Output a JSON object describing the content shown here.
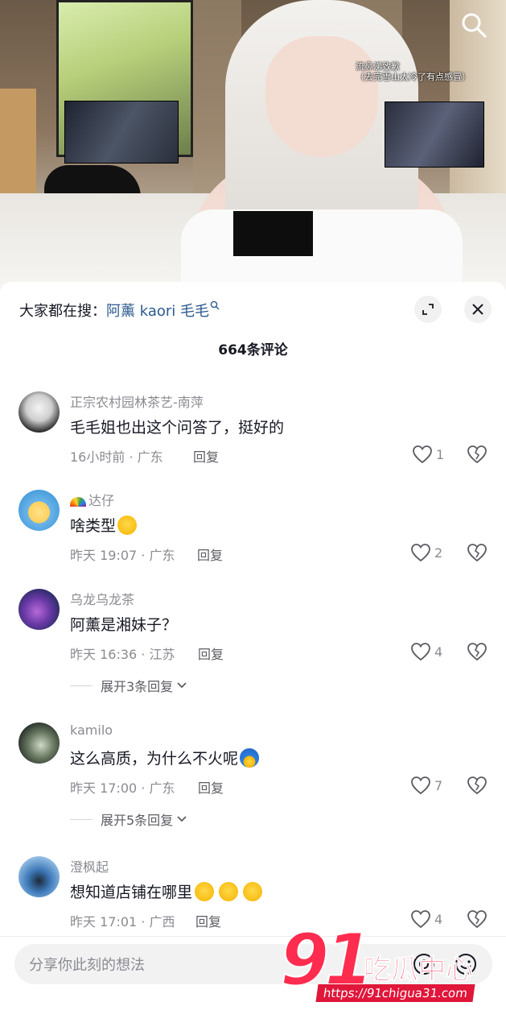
{
  "video": {
    "overlay_line1": "流鼻涕致歉",
    "overlay_line2": "（去完雪山太冷了有点感冒）",
    "search_icon": "search-icon"
  },
  "sheet": {
    "suggest_prefix": "大家都在搜：",
    "suggest_keyword": "阿薰 kaori 毛毛",
    "comment_count": "664条评论",
    "expand_icon": "collapse-arrows-icon",
    "close_icon": "close-icon"
  },
  "comments": [
    {
      "username": "正宗农村园林茶艺-南萍",
      "text": "毛毛姐也出这个问答了，挺好的",
      "time": "16小时前",
      "location": "广东",
      "reply": "回复",
      "likes": "1"
    },
    {
      "username": "达仔",
      "text": "啥类型",
      "time": "昨天 19:07",
      "location": "广东",
      "reply": "回复",
      "likes": "2"
    },
    {
      "username": "乌龙乌龙茶",
      "text": "阿薰是湘妹子？",
      "time": "昨天 16:36",
      "location": "江苏",
      "reply": "回复",
      "likes": "4",
      "expand": "展开3条回复"
    },
    {
      "username": "kamilo",
      "text": "这么高质，为什么不火呢",
      "time": "昨天 17:00",
      "location": "广东",
      "reply": "回复",
      "likes": "7",
      "expand": "展开5条回复"
    },
    {
      "username": "澄枫起",
      "text": "想知道店铺在哪里",
      "time": "昨天 17:01",
      "location": "广西",
      "reply": "回复",
      "likes": "4"
    }
  ],
  "input": {
    "placeholder": "分享你此刻的想法"
  },
  "watermark": {
    "number": "91",
    "chinese": "吃瓜中心",
    "url": "https://91chigua31.com"
  },
  "colors": {
    "accent_link": "#2b5a8e",
    "watermark": "#ff2c4f"
  }
}
